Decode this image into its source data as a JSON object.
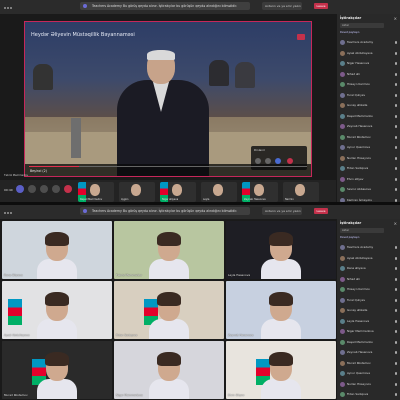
{
  "meeting": {
    "banner_label": "Teachers Academy",
    "banner_text": "Bu görüş qeydə alınır. İştirakçılar bu görüşün qeydə alındığını bilməlidir.",
    "search_placeholder": "Axtarın və ya əmr yazın",
    "leave_label": "Leave"
  },
  "screen1": {
    "call_time": "00:40",
    "presenter": "Təbriz Məmmədov",
    "video_caption": "Heydər Əliyevin Müstəqillik Bəyannaməsi",
    "video_timecode": "Beşinci (2)",
    "popup_title": "Dinlənir",
    "progress": 0.18,
    "thumbnails": [
      {
        "name": "Rəşad Məmmədov"
      },
      {
        "name": "Aygün"
      },
      {
        "name": "Nigar Əliyeva"
      },
      {
        "name": "Leyla"
      },
      {
        "name": "Zeynəb Həsənova"
      },
      {
        "name": "Nərmin"
      }
    ],
    "sidebar": {
      "title": "İştirakçılar",
      "search_placeholder": "Axtar",
      "share_label": "Dəvət paylaşın",
      "participants": [
        "Teachers Academy",
        "Aysel Abdullayeva",
        "Nigar Həsənova",
        "Nihad Əli",
        "Hüseyn Kərimov",
        "Tural Quliyev",
        "Gunay Əlizadə",
        "Rəşad Məmmədov",
        "Zeynəb Həsənova",
        "Murad Rüstəmov",
        "Aynur Qasımova",
        "Nurlan Hüseynov",
        "Fidan Sadıqova",
        "Elvin Əliyev",
        "Sevinc Abbasova",
        "Kamran İsmayılov"
      ]
    }
  },
  "screen2": {
    "tiles": [
      {
        "name": "Rəna Əliyeva"
      },
      {
        "name": "Təbriz Məmmədov"
      },
      {
        "name": "Leyla Həsənova"
      },
      {
        "name": "Aysel Abdullayeva"
      },
      {
        "name": "Fidan Sadıqova"
      },
      {
        "name": "Zeynəb Həsənova"
      },
      {
        "name": "Murad Rüstəmov"
      },
      {
        "name": "Nigar Məmmədova"
      },
      {
        "name": "Elvin Əliyev"
      }
    ],
    "sidebar": {
      "title": "İştirakçılar",
      "search_placeholder": "Axtar",
      "share_label": "Dəvət paylaşın",
      "participants": [
        "Teachers Academy",
        "Aysel Abdullayeva",
        "Rəna Əliyeva",
        "Nihad Əli",
        "Hüseyn Kərimov",
        "Tural Quliyev",
        "Gunay Əlizadə",
        "Leyla Həsənova",
        "Nigar Məmmədova",
        "Rəşad Məmmədov",
        "Zeynəb Həsənova",
        "Murad Rüstəmov",
        "Aynur Qasımova",
        "Nurlan Hüseynov",
        "Fidan Sadıqova",
        "Elvin Əliyev"
      ]
    }
  }
}
